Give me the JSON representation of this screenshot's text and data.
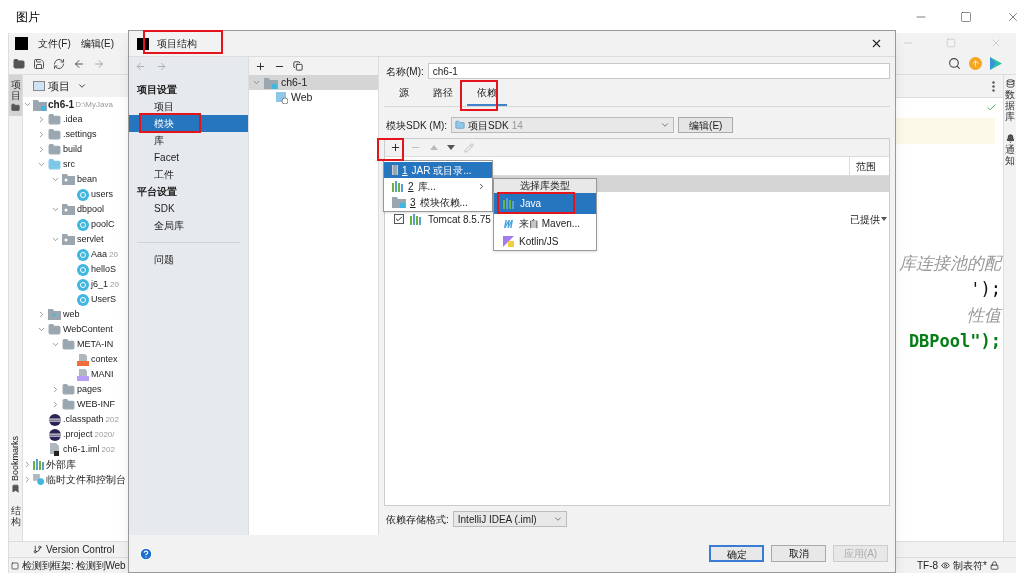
{
  "window": {
    "title": "图片"
  },
  "ide": {
    "menu": [
      "文件(F)",
      "编辑(E)"
    ],
    "left_tool_top": "项目",
    "left_tool_bottom": [
      {
        "label": "Bookmarks",
        "kind": "latin"
      },
      {
        "label": "结构",
        "kind": "cjk"
      }
    ],
    "project_header": "项目",
    "tree": [
      {
        "label": "ch6-1",
        "hint": "D:\\MyJava",
        "kind": "module",
        "bold": true,
        "expanded": true,
        "children": [
          {
            "label": ".idea",
            "kind": "folder",
            "expanded": false
          },
          {
            "label": ".settings",
            "kind": "folder",
            "expanded": false
          },
          {
            "label": "build",
            "kind": "folder",
            "expanded": false
          },
          {
            "label": "src",
            "kind": "source",
            "expanded": true,
            "children": [
              {
                "label": "bean",
                "kind": "package",
                "expanded": true,
                "children": [
                  {
                    "label": "users",
                    "kind": "class"
                  }
                ]
              },
              {
                "label": "dbpool",
                "kind": "package",
                "expanded": true,
                "children": [
                  {
                    "label": "poolC",
                    "kind": "class"
                  }
                ]
              },
              {
                "label": "servlet",
                "kind": "package",
                "expanded": true,
                "children": [
                  {
                    "label": "Aaa",
                    "hint": "20",
                    "kind": "class"
                  },
                  {
                    "label": "helloS",
                    "kind": "class"
                  },
                  {
                    "label": "j6_1",
                    "hint": "20",
                    "kind": "class"
                  },
                  {
                    "label": "UserS",
                    "kind": "class"
                  }
                ]
              }
            ]
          },
          {
            "label": "web",
            "kind": "webfolder",
            "expanded": false
          },
          {
            "label": "WebContent",
            "kind": "folder",
            "expanded": true,
            "children": [
              {
                "label": "META-IN",
                "kind": "folder",
                "expanded": true,
                "children": [
                  {
                    "label": "contex",
                    "kind": "xml"
                  },
                  {
                    "label": "MANI",
                    "kind": "manifest"
                  }
                ]
              },
              {
                "label": "pages",
                "kind": "folder",
                "expanded": false
              },
              {
                "label": "WEB-INF",
                "kind": "folder",
                "expanded": false
              }
            ]
          },
          {
            "label": ".classpath",
            "hint": "202",
            "kind": "eclipse"
          },
          {
            "label": ".project",
            "hint": "2020/",
            "kind": "eclipse"
          },
          {
            "label": "ch6-1.iml",
            "hint": "202",
            "kind": "iml"
          }
        ]
      },
      {
        "label": "外部库",
        "kind": "library",
        "expanded": false
      },
      {
        "label": "临时文件和控制台",
        "kind": "scratch",
        "expanded": false
      }
    ],
    "right_tool": [
      "数据库",
      "通知"
    ],
    "code_lines": [
      {
        "text": "库连接池的配",
        "kind": "comment"
      },
      {
        "text": "');",
        "kind": "code"
      },
      {
        "text": "性值",
        "kind": "comment"
      },
      {
        "text": "DBPool\");",
        "kind": "string"
      }
    ],
    "bottom_tab": "Version Control",
    "status": "检测到框架: 检测到Web",
    "status_right": [
      "TF-8",
      "制表符*"
    ]
  },
  "dialog": {
    "title": "项目结构",
    "nav": [
      {
        "kind": "section",
        "label": "项目设置"
      },
      {
        "kind": "item",
        "label": "项目",
        "selected": false
      },
      {
        "kind": "item",
        "label": "模块",
        "selected": true
      },
      {
        "kind": "item",
        "label": "库",
        "selected": false
      },
      {
        "kind": "item",
        "label": "Facet",
        "selected": false
      },
      {
        "kind": "item",
        "label": "工件",
        "selected": false
      },
      {
        "kind": "section",
        "label": "平台设置"
      },
      {
        "kind": "item",
        "label": "SDK",
        "selected": false
      },
      {
        "kind": "item",
        "label": "全局库",
        "selected": false
      },
      {
        "kind": "separator"
      },
      {
        "kind": "item",
        "label": "问题",
        "selected": false
      }
    ],
    "module_tree": [
      {
        "label": "ch6-1",
        "selected": true,
        "expanded": true,
        "children": [
          {
            "label": "Web",
            "selected": false
          }
        ]
      }
    ],
    "name_label": "名称(M):",
    "name_value": "ch6-1",
    "tabs": [
      {
        "label": "源",
        "selected": false
      },
      {
        "label": "路径",
        "selected": false
      },
      {
        "label": "依赖",
        "selected": true
      }
    ],
    "sdk_label": "模块SDK (M):",
    "sdk_value": "项目SDK",
    "sdk_version": "14",
    "edit_button": "编辑(E)",
    "table": {
      "columns": [
        "范围"
      ],
      "rows": [
        {
          "kind": "blank",
          "selected": true
        },
        {
          "kind": "library",
          "selected": false,
          "checked": true,
          "name": "Tomcat 8.5.75",
          "scope": "已提供"
        }
      ]
    },
    "storage_label": "依赖存储格式:",
    "storage_value": "IntelliJ IDEA (.iml)",
    "buttons": [
      {
        "label": "确定",
        "kind": "default"
      },
      {
        "label": "取消",
        "kind": "normal"
      },
      {
        "label": "应用(A)",
        "kind": "disabled"
      }
    ]
  },
  "add_menu": [
    {
      "mnemonic": "1",
      "label": "JAR 或目录...",
      "kind": "jar",
      "selected": true,
      "submenu": false
    },
    {
      "mnemonic": "2",
      "label": "库...",
      "kind": "library",
      "selected": false,
      "submenu": true
    },
    {
      "mnemonic": "3",
      "label": "模块依赖...",
      "kind": "module",
      "selected": false,
      "submenu": false
    }
  ],
  "library_menu": {
    "title": "选择库类型",
    "items": [
      {
        "label": "Java",
        "kind": "java",
        "selected": true
      },
      {
        "label": "来自 Maven...",
        "kind": "maven",
        "selected": false
      },
      {
        "label": "Kotlin/JS",
        "kind": "kotlin",
        "selected": false
      }
    ]
  }
}
